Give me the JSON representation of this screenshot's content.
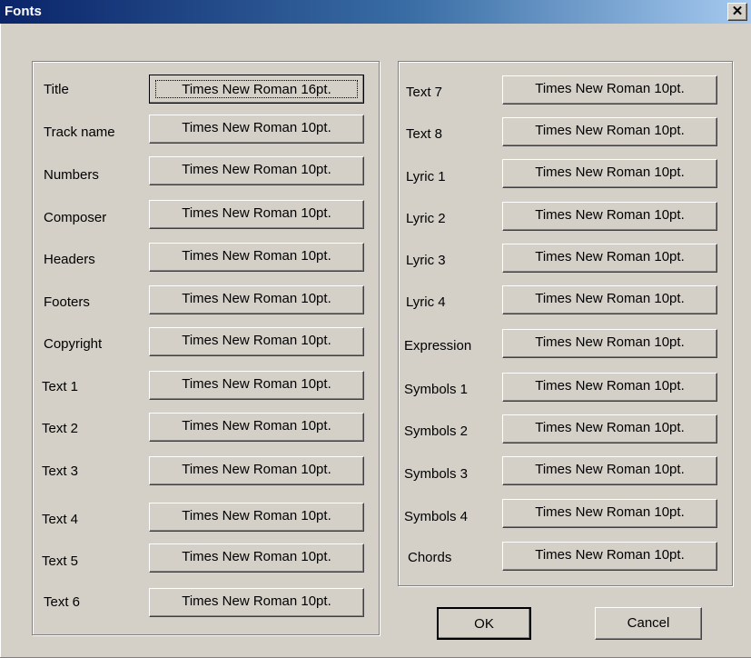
{
  "window": {
    "title": "Fonts",
    "close_glyph": "✕"
  },
  "left_rows": [
    {
      "label": "Title",
      "font": "Times New Roman 16pt."
    },
    {
      "label": "Track name",
      "font": "Times New Roman 10pt."
    },
    {
      "label": "Numbers",
      "font": "Times New Roman 10pt."
    },
    {
      "label": "Composer",
      "font": "Times New Roman 10pt."
    },
    {
      "label": "Headers",
      "font": "Times New Roman 10pt."
    },
    {
      "label": "Footers",
      "font": "Times New Roman 10pt."
    },
    {
      "label": "Copyright",
      "font": "Times New Roman 10pt."
    },
    {
      "label": "Text 1",
      "font": "Times New Roman 10pt."
    },
    {
      "label": "Text 2",
      "font": "Times New Roman 10pt."
    },
    {
      "label": "Text 3",
      "font": "Times New Roman 10pt."
    },
    {
      "label": "Text 4",
      "font": "Times New Roman 10pt."
    },
    {
      "label": "Text 5",
      "font": "Times New Roman 10pt."
    },
    {
      "label": "Text 6",
      "font": "Times New Roman 10pt."
    }
  ],
  "right_rows": [
    {
      "label": "Text 7",
      "font": "Times New Roman 10pt."
    },
    {
      "label": "Text 8",
      "font": "Times New Roman 10pt."
    },
    {
      "label": "Lyric 1",
      "font": "Times New Roman 10pt."
    },
    {
      "label": "Lyric 2",
      "font": "Times New Roman 10pt."
    },
    {
      "label": "Lyric 3",
      "font": "Times New Roman 10pt."
    },
    {
      "label": "Lyric 4",
      "font": "Times New Roman 10pt."
    },
    {
      "label": "Expression",
      "font": "Times New Roman 10pt."
    },
    {
      "label": "Symbols 1",
      "font": "Times New Roman 10pt."
    },
    {
      "label": "Symbols 2",
      "font": "Times New Roman 10pt."
    },
    {
      "label": "Symbols 3",
      "font": "Times New Roman 10pt."
    },
    {
      "label": "Symbols 4",
      "font": "Times New Roman 10pt."
    },
    {
      "label": "Chords",
      "font": "Times New Roman 10pt."
    }
  ],
  "buttons": {
    "ok": "OK",
    "cancel": "Cancel"
  }
}
